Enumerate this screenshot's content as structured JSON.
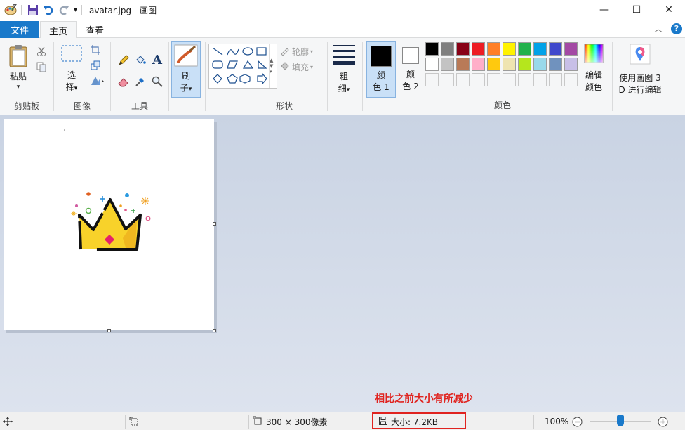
{
  "window": {
    "title": "avatar.jpg - 画图",
    "minimize": "—",
    "maximize": "☐",
    "close": "✕"
  },
  "tabs": {
    "file": "文件",
    "home": "主页",
    "view": "查看"
  },
  "ribbon": {
    "clipboard": {
      "paste": "粘贴",
      "paste_arrow": "▾",
      "group": "剪贴板"
    },
    "image": {
      "select_line1": "选",
      "select_line2": "择",
      "select_arrow": "▾",
      "group": "图像"
    },
    "tools": {
      "text_tool": "A",
      "group": "工具"
    },
    "brushes": {
      "line1": "刷",
      "line2": "子",
      "arrow": "▾"
    },
    "shapes": {
      "outline": "轮廓",
      "fill": "填充",
      "group": "形状"
    },
    "size": {
      "line1": "粗",
      "line2": "细",
      "arrow": "▾"
    },
    "color1": {
      "line1": "颜",
      "line2": "色 1"
    },
    "color2": {
      "line1": "颜",
      "line2": "色 2"
    },
    "colors": {
      "group": "颜色",
      "row1": [
        "#000000",
        "#7f7f7f",
        "#880015",
        "#ed1c24",
        "#ff7f27",
        "#fff200",
        "#22b14c",
        "#00a2e8",
        "#3f48cc",
        "#a349a4"
      ],
      "row2": [
        "#ffffff",
        "#c3c3c3",
        "#b97a57",
        "#ffaec9",
        "#ffc90e",
        "#efe4b0",
        "#b5e61d",
        "#99d9ea",
        "#7092be",
        "#c8bfe7"
      ],
      "color1_value": "#000000",
      "color2_value": "#ffffff"
    },
    "edit_colors": {
      "line1": "编辑",
      "line2": "颜色"
    },
    "paint3d": {
      "line1": "使用画图 3",
      "line2": "D 进行编辑"
    }
  },
  "annotation": "相比之前大小有所减少",
  "status": {
    "dimensions": "300 × 300像素",
    "size": "大小: 7.2KB",
    "zoom": "100%"
  }
}
